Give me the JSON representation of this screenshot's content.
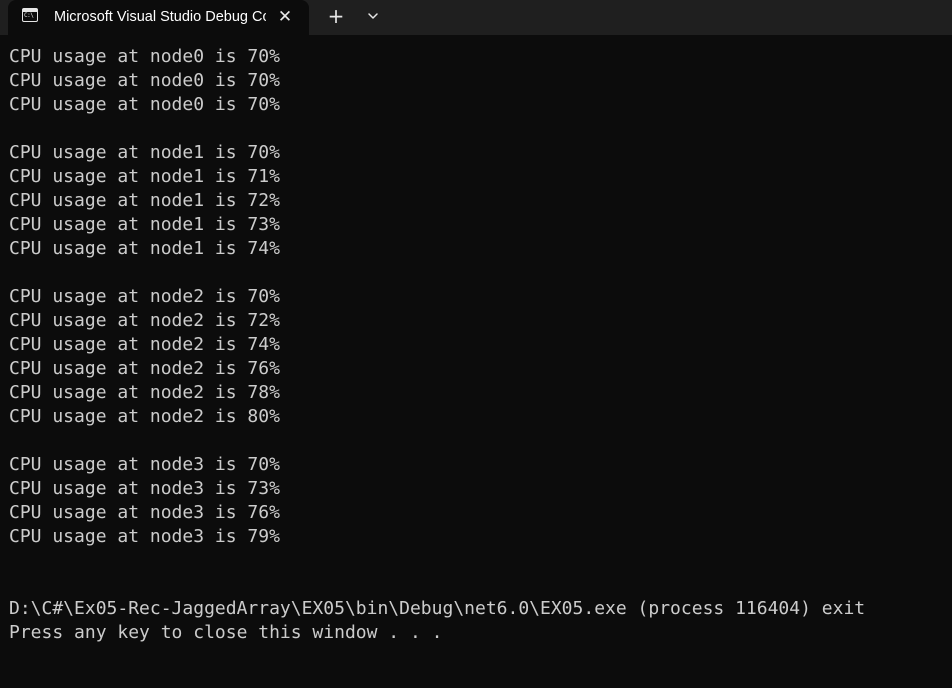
{
  "tab": {
    "icon_text": "C:\\",
    "title": "Microsoft Visual Studio Debug Console",
    "close_glyph": "✕",
    "new_tab_glyph": "+"
  },
  "console": {
    "lines": [
      "CPU usage at node0 is 70%",
      "CPU usage at node0 is 70%",
      "CPU usage at node0 is 70%",
      "",
      "CPU usage at node1 is 70%",
      "CPU usage at node1 is 71%",
      "CPU usage at node1 is 72%",
      "CPU usage at node1 is 73%",
      "CPU usage at node1 is 74%",
      "",
      "CPU usage at node2 is 70%",
      "CPU usage at node2 is 72%",
      "CPU usage at node2 is 74%",
      "CPU usage at node2 is 76%",
      "CPU usage at node2 is 78%",
      "CPU usage at node2 is 80%",
      "",
      "CPU usage at node3 is 70%",
      "CPU usage at node3 is 73%",
      "CPU usage at node3 is 76%",
      "CPU usage at node3 is 79%",
      "",
      "",
      "D:\\C#\\Ex05-Rec-JaggedArray\\EX05\\bin\\Debug\\net6.0\\EX05.exe (process 116404) exit",
      "Press any key to close this window . . ."
    ]
  },
  "colors": {
    "background": "#0c0c0c",
    "titlebar": "#1f1f1f",
    "text": "#cccccc"
  }
}
